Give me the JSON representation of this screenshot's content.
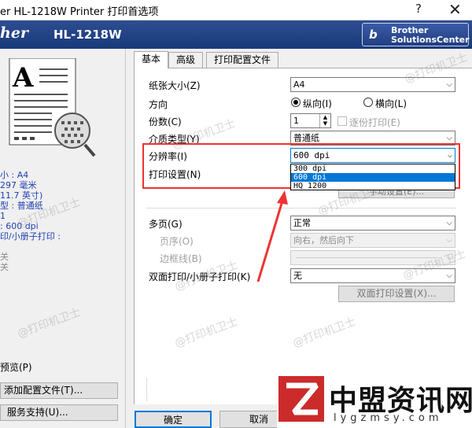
{
  "window": {
    "title": "er HL-1218W Printer 打印首选项",
    "help": "?",
    "close": "✕"
  },
  "banner": {
    "brand": "her",
    "model": "HL-1218W",
    "solutions_line1": "Brother",
    "solutions_line2": "SolutionsCenter"
  },
  "left": {
    "preview_letter": "A",
    "info": [
      "小 : A4",
      "297 毫米",
      "11.7 英寸)",
      "型 : 普通纸",
      "1",
      ": 600 dpi",
      "印/小册子打印 :",
      "",
      "关",
      "关"
    ],
    "preview_label": "预览(P)",
    "add_profile_button": "添加配置文件(T)...",
    "support_button": "服务支持(U)..."
  },
  "tabs": [
    "基本",
    "高级",
    "打印配置文件"
  ],
  "form": {
    "paper_size_label": "纸张大小(Z)",
    "paper_size_value": "A4",
    "orientation_label": "方向",
    "portrait_label": "纵向(I)",
    "landscape_label": "横向(L)",
    "copies_label": "份数(C)",
    "copies_value": "1",
    "collate_label": "逐份打印(E)",
    "media_label": "介质类型(Y)",
    "media_value": "普通纸",
    "resolution_label": "分辨率(I)",
    "resolution_value": "600 dpi",
    "resolution_options": [
      "300 dpi",
      "600 dpi",
      "HQ 1200"
    ],
    "print_settings_label": "打印设置(N)",
    "hidden_button_fragment": "手动设置(E)...",
    "multipage_label": "多页(G)",
    "multipage_value": "正常",
    "page_order_label": "页序(O)",
    "page_order_value": "向右，然后向下",
    "border_label": "边框线(B)",
    "duplex_label": "双面打印/小册子打印(K)",
    "duplex_value": "无",
    "duplex_settings_button": "双面打印设置(X)..."
  },
  "buttons": {
    "ok": "确定",
    "cancel": "取消"
  },
  "watermark": "@打印机卫士",
  "logo": {
    "name": "中盟资讯网",
    "url": "lygzmsy.com",
    "mark": "Z"
  },
  "colors": {
    "banner": "#1f4286",
    "highlight": "#e33333",
    "selection": "#0078d7",
    "logo_red": "#cc2b2b"
  }
}
